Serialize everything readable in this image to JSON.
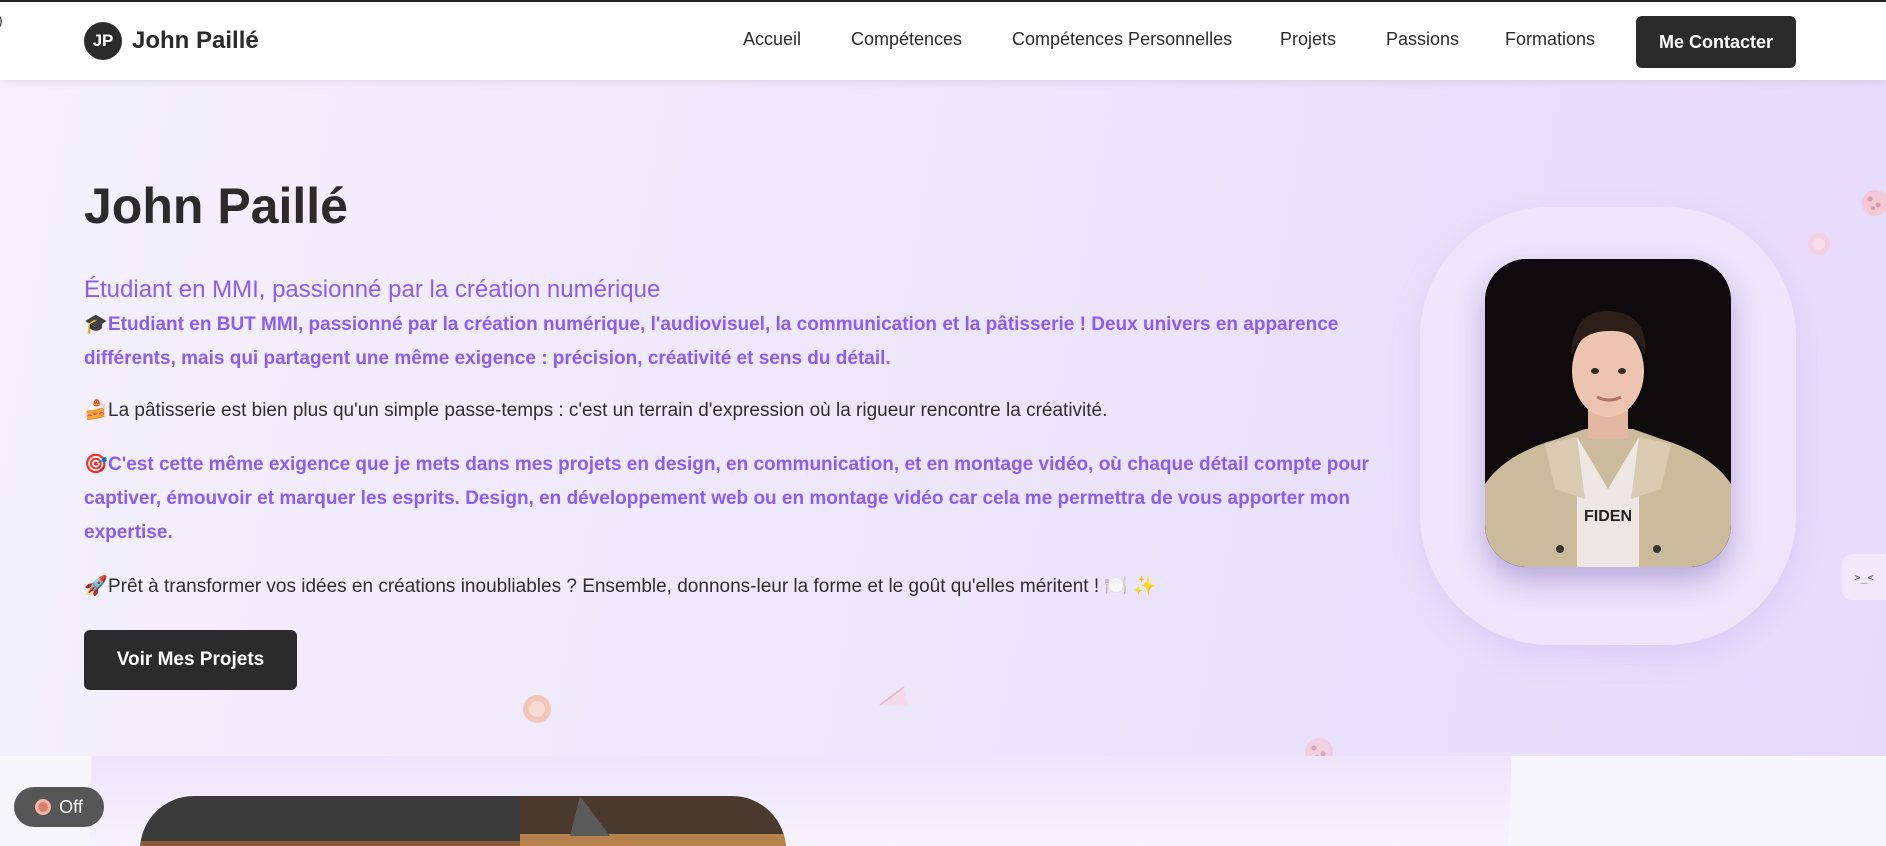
{
  "brand": {
    "logo_text": "JP",
    "name": "John Paillé"
  },
  "nav": {
    "links": [
      "Accueil",
      "Compétences",
      "Compétences Personnelles",
      "Projets",
      "Passions",
      "Formations"
    ],
    "cta": "Me Contacter"
  },
  "hero": {
    "title": "John Paillé",
    "subtitle": "Étudiant en MMI, passionné par la création numérique",
    "paragraphs": [
      {
        "emoji": "🎓",
        "text": "Etudiant en BUT MMI, passionné par la création numérique, l'audiovisuel, la communication et la pâtisserie ! Deux univers en apparence différents, mais qui partagent une même exigence : précision, créativité et sens du détail."
      },
      {
        "emoji": "🍰",
        "text": "La pâtisserie est bien plus qu'un simple passe-temps : c'est un terrain d'expression où la rigueur rencontre la créativité."
      },
      {
        "emoji": "🎯",
        "text": "C'est cette même exigence que je mets dans mes projets en design, en communication, et en montage vidéo, où chaque détail compte pour captiver, émouvoir et marquer les esprits. Design, en développement web ou en montage vidéo car cela me permettra de vous apporter mon expertise."
      },
      {
        "emoji": "🚀",
        "text": "Prêt à transformer vos idées en créations inoubliables ? Ensemble, donnons-leur la forme et le goût qu'elles méritent ! 🍽️ ✨"
      }
    ],
    "button": "Voir Mes Projets",
    "portrait_shirt_text": "FIDEN"
  },
  "side_tab": {
    "text": ">_<"
  },
  "toggle": {
    "label": "Off"
  },
  "colors": {
    "accent": "#8b5cf6",
    "dark": "#2b2b2b",
    "hero_bg": "#ece6fb"
  }
}
